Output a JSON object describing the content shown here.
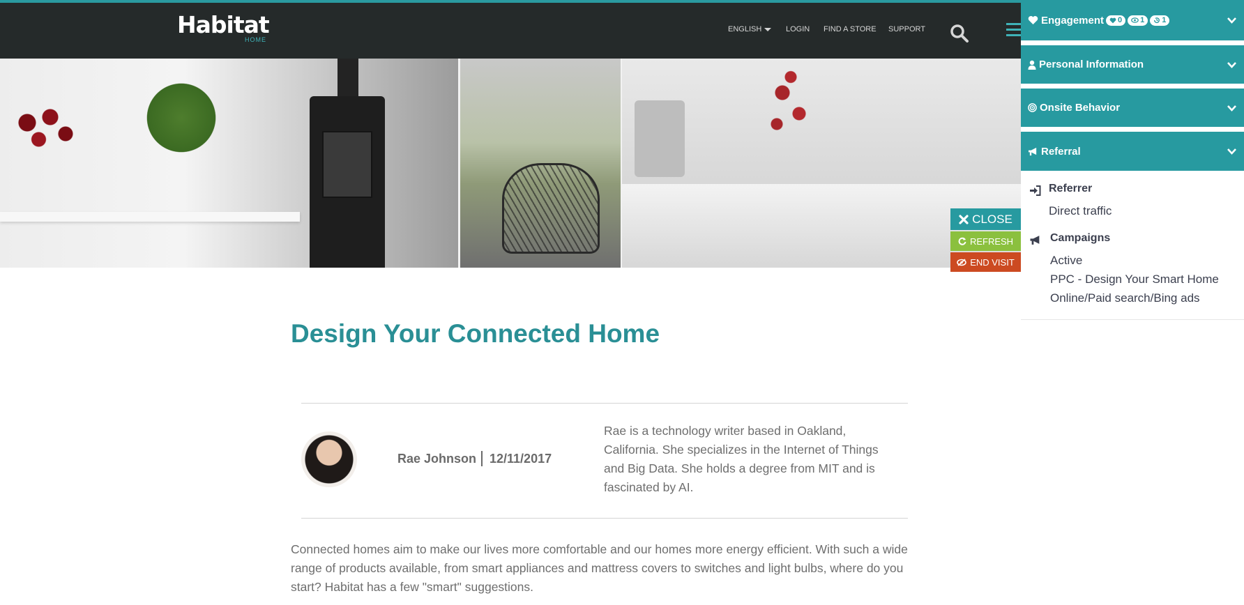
{
  "header": {
    "logo": "Habitat",
    "logo_sub": "HOME",
    "nav": [
      "ENGLISH",
      "LOGIN",
      "FIND A STORE",
      "SUPPORT"
    ]
  },
  "overlay_buttons": {
    "close": "CLOSE",
    "refresh": "REFRESH",
    "end_visit": "END VISIT"
  },
  "article": {
    "title": "Design Your Connected Home",
    "author": "Rae Johnson",
    "date": "12/11/2017",
    "bio": "Rae is a technology writer based in Oakland, California. She specializes in the Internet of Things and Big Data. She holds a degree from MIT and is fascinated by AI.",
    "body": "Connected homes aim to make our lives more comfortable and our homes more energy efficient. With such a wide range of products available, from smart appliances and mattress covers to switches and light bulbs, where do you start? Habitat has a few \"smart\" suggestions."
  },
  "sidebar": {
    "sections": {
      "engagement": {
        "label": "Engagement",
        "counts": {
          "likes": "0",
          "views": "1",
          "history": "1"
        }
      },
      "personal": {
        "label": "Personal Information"
      },
      "onsite": {
        "label": "Onsite Behavior"
      },
      "referral": {
        "label": "Referral"
      }
    },
    "referral": {
      "referrer_label": "Referrer",
      "referrer_value": "Direct traffic",
      "campaigns_label": "Campaigns",
      "campaigns_status": "Active",
      "campaign_name_prefix": "PPC - ",
      "campaign_name": "Design Your Smart Home",
      "campaign_channel": "Online/Paid search/Bing ads"
    }
  },
  "colors": {
    "brand_teal": "#279aa0",
    "header_dark": "#252a2a",
    "refresh_green": "#8bc03e",
    "end_visit_red": "#cc4a21"
  },
  "icons": [
    "search-icon",
    "menu-icon",
    "times-icon",
    "refresh-icon",
    "eye-slash-icon",
    "heart-icon",
    "eye-icon",
    "history-icon",
    "user-icon",
    "target-icon",
    "bullhorn-icon",
    "sign-in-icon",
    "chevron-down-icon"
  ]
}
